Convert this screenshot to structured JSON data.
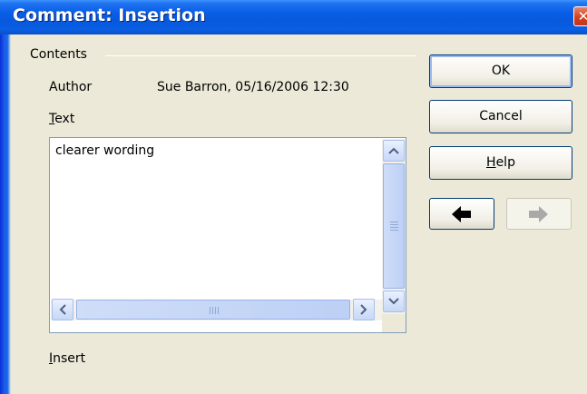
{
  "window": {
    "title": "Comment: Insertion",
    "close_glyph": "✕"
  },
  "contents": {
    "group_title": "Contents",
    "author_label": "Author",
    "author_value": "Sue Barron, 05/16/2006 12:30",
    "text_label": "Text",
    "text_value": "clearer wording",
    "insert_label": "Insert"
  },
  "buttons": {
    "ok": "OK",
    "cancel": "Cancel",
    "help": "Help"
  },
  "nav": {
    "previous_icon": "arrow-left-icon",
    "next_icon": "arrow-right-icon",
    "next_disabled": true
  },
  "colors": {
    "title_bar": "#0a5fe8",
    "dialog_bg": "#ece9d8"
  }
}
